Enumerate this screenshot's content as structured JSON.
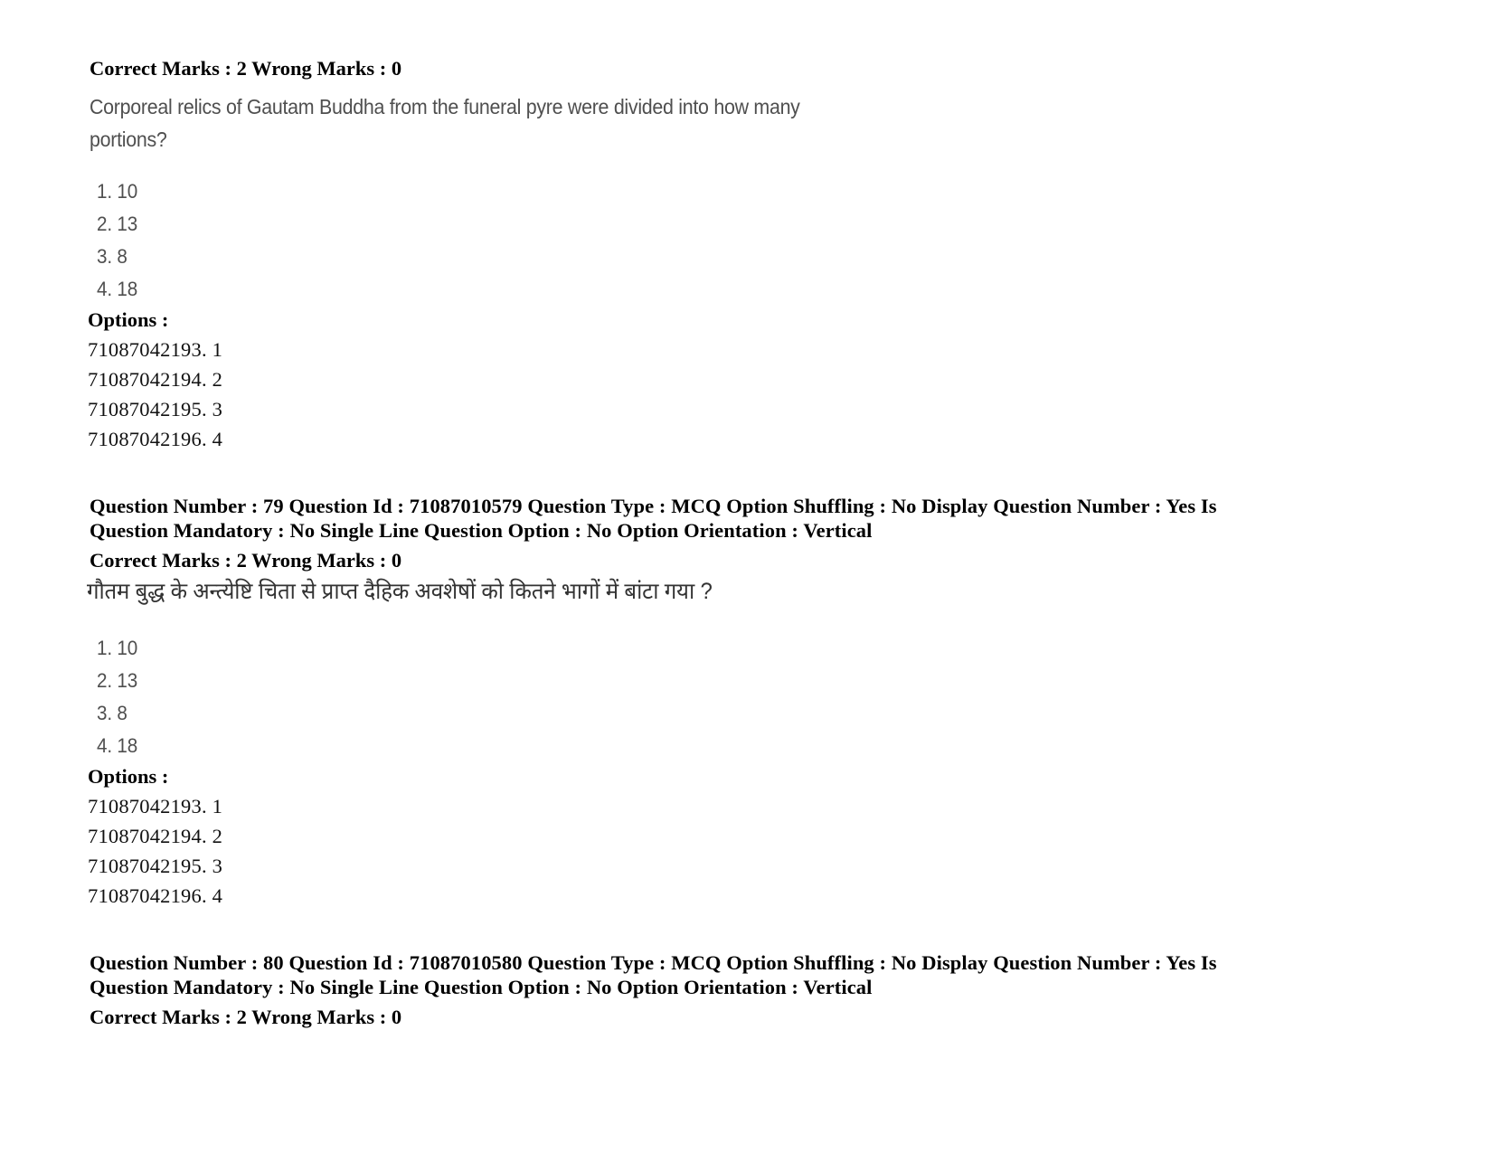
{
  "document": {
    "type": "exam-question-paper-page",
    "background_color": "#ffffff",
    "text_color_meta": "#000000",
    "text_color_question": "#4f4f4f"
  },
  "blocks": {
    "q78_tail": {
      "marks_line": "Correct Marks : 2 Wrong Marks : 0",
      "question_text_line1": "Corporeal relics of Gautam Buddha from the funeral pyre were divided into how many",
      "question_text_line2": "portions?",
      "choices": [
        "1. 10",
        "2. 13",
        "3. 8",
        "4. 18"
      ],
      "options_label": "Options :",
      "option_ids": [
        "71087042193. 1",
        "71087042194. 2",
        "71087042195. 3",
        "71087042196. 4"
      ]
    },
    "q79": {
      "meta_line1": "Question Number : 79 Question Id : 71087010579 Question Type : MCQ Option Shuffling : No Display Question Number : Yes Is",
      "meta_line2": "Question Mandatory : No Single Line Question Option : No Option Orientation : Vertical",
      "marks_line": "Correct Marks : 2 Wrong Marks : 0",
      "question_text_hindi": "गौतम बुद्ध के अन्त्येष्टि चिता से प्राप्त दैहिक अवशेषों को कितने भागों में बांटा गया ?",
      "choices": [
        "1. 10",
        "2. 13",
        "3. 8",
        "4. 18"
      ],
      "options_label": "Options :",
      "option_ids": [
        "71087042193. 1",
        "71087042194. 2",
        "71087042195. 3",
        "71087042196. 4"
      ]
    },
    "q80": {
      "meta_line1": "Question Number : 80 Question Id : 71087010580 Question Type : MCQ Option Shuffling : No Display Question Number : Yes Is",
      "meta_line2": "Question Mandatory : No Single Line Question Option : No Option Orientation : Vertical",
      "marks_line": "Correct Marks : 2 Wrong Marks : 0"
    }
  }
}
